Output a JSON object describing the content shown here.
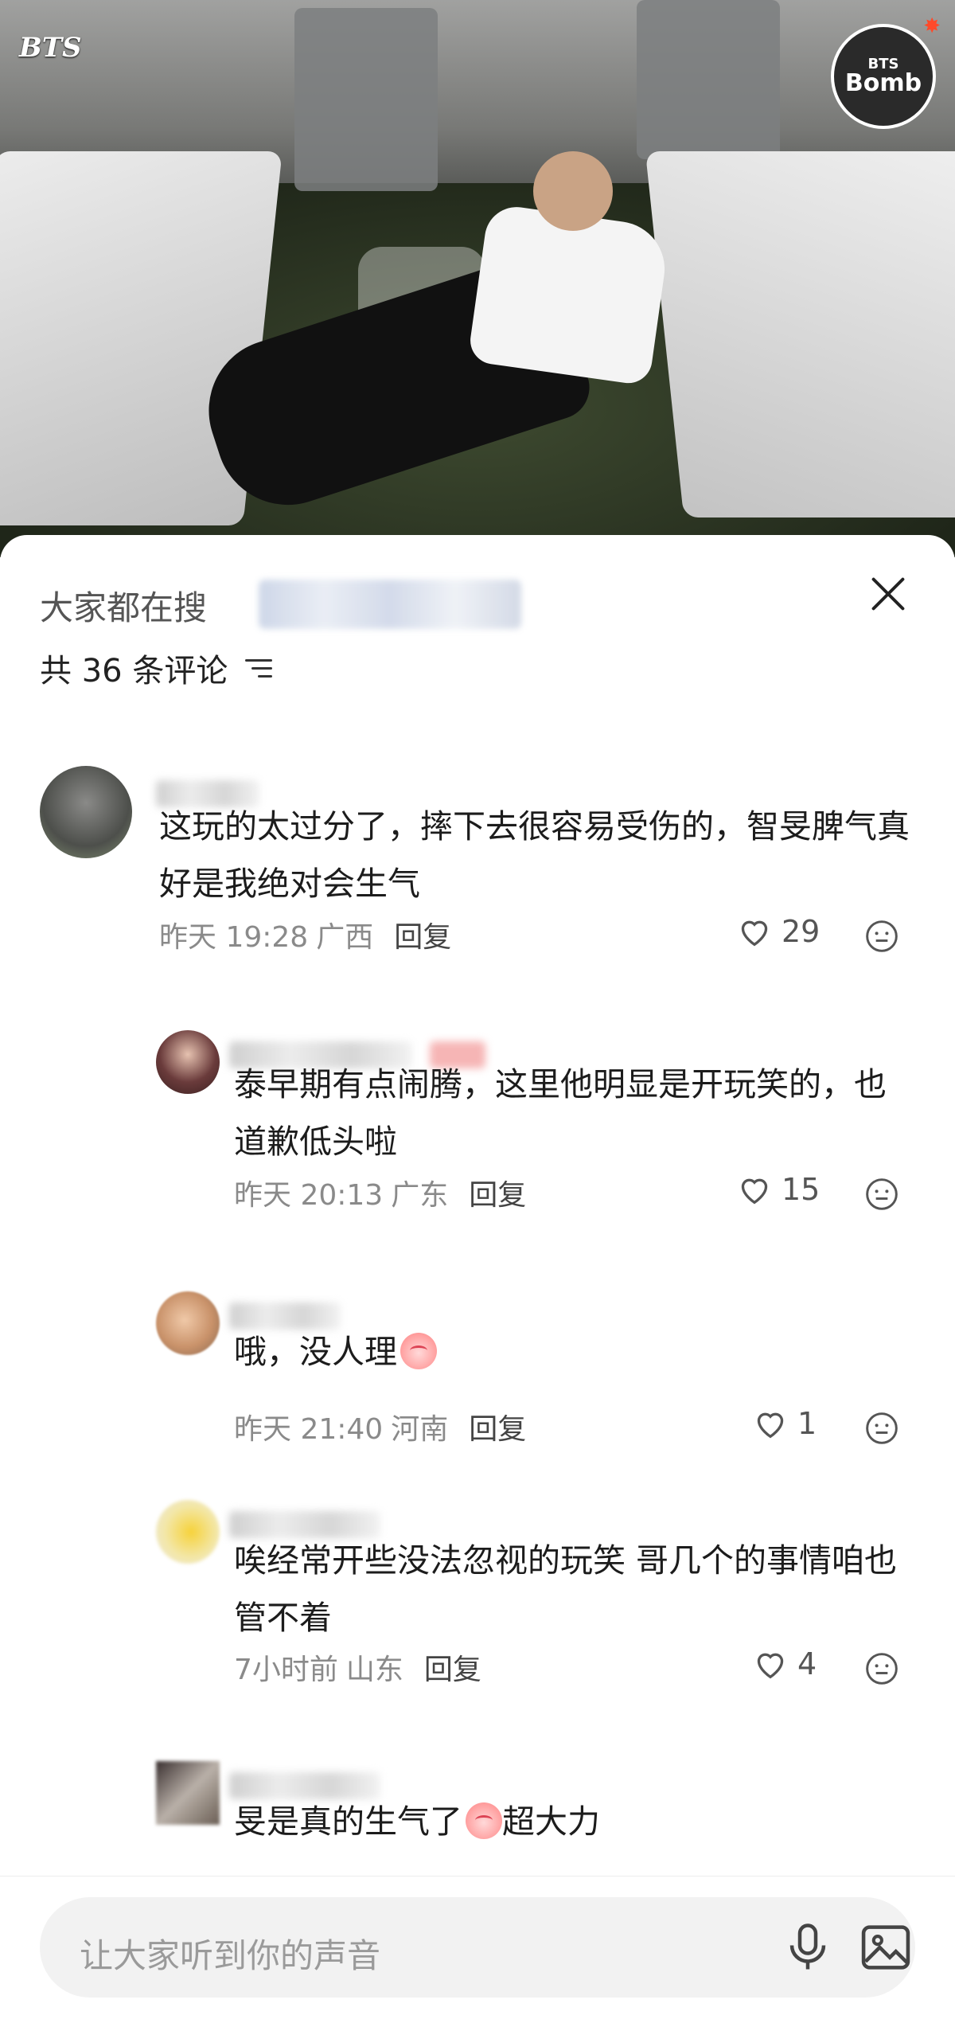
{
  "video": {
    "logo_left": "BTS",
    "logo_right_top": "BTS",
    "logo_right_bottom": "Bomb"
  },
  "sheet": {
    "search_prefix": "大家都在搜",
    "comment_count": "共 36 条评论",
    "close_icon": "close-icon",
    "filter_icon": "filter-icon"
  },
  "comments": [
    {
      "text": "这玩的太过分了，摔下去很容易受伤的，智旻脾气真好是我绝对会生气",
      "time": "昨天 19:28",
      "location": "广西",
      "reply": "回复",
      "likes": "29"
    },
    {
      "text": "泰早期有点闹腾，这里他明显是开玩笑的，也道歉低头啦",
      "time": "昨天 20:13",
      "location": "广东",
      "reply": "回复",
      "likes": "15"
    },
    {
      "text": "哦，没人理",
      "time": "昨天 21:40",
      "location": "河南",
      "reply": "回复",
      "likes": "1"
    },
    {
      "text": "唉经常开些没法忽视的玩笑 哥几个的事情咱也管不着",
      "time": "7小时前",
      "location": "山东",
      "reply": "回复",
      "likes": "4"
    },
    {
      "text_before": "旻是真的生气了",
      "text_after": "超大力"
    }
  ],
  "input": {
    "placeholder": "让大家听到你的声音",
    "mic_icon": "microphone-icon",
    "image_icon": "image-icon"
  },
  "colors": {
    "accent_badge": "#f26b6b",
    "meta_gray": "#8a8a8a"
  }
}
